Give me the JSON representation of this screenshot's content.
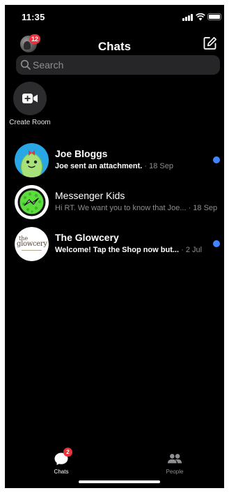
{
  "status_bar": {
    "time": "11:35"
  },
  "header": {
    "title": "Chats",
    "profile_badge": "12"
  },
  "search": {
    "placeholder": "Search"
  },
  "create_room": {
    "label": "Create Room"
  },
  "chats": [
    {
      "name": "Joe Bloggs",
      "preview": "Joe sent an attachment.",
      "time": "· 18 Sep",
      "unread": true,
      "avatar_icon": "joe-bloggs-cartoon-avatar"
    },
    {
      "name": "Messenger Kids",
      "preview": "Hi RT. We want you to know that Joe...",
      "time": "· 18 Sep",
      "unread": false,
      "avatar_icon": "messenger-kids-logo"
    },
    {
      "name": "The Glowcery",
      "preview": "Welcome! Tap the Shop now but...",
      "time": "· 2 Jul",
      "unread": true,
      "avatar_icon": "glowcery-logo",
      "logo_text": {
        "the": "the",
        "name": "glowcery"
      }
    }
  ],
  "tab_bar": {
    "chats": {
      "label": "Chats",
      "badge": "2",
      "active": true
    },
    "people": {
      "label": "People",
      "active": false
    }
  },
  "colors": {
    "background": "#000000",
    "accent_blue": "#3f86ff",
    "badge_red": "#e8323c",
    "search_bg": "#262628",
    "secondary_text": "#8e8e93"
  }
}
